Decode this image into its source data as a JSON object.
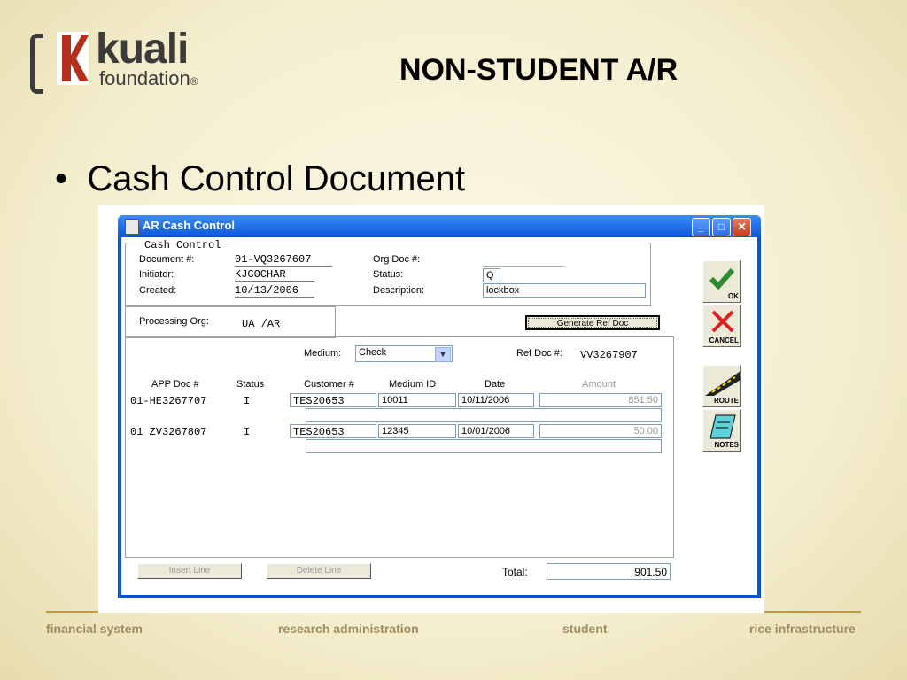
{
  "slide": {
    "logo_name": "kuali",
    "logo_sub": "foundation",
    "logo_reg": "®",
    "title": "NON-STUDENT A/R",
    "bullet": "Cash Control Document",
    "footer": [
      "financial system",
      "research administration",
      "student",
      "rice infrastructure"
    ]
  },
  "window": {
    "title": "AR Cash Control",
    "controls": {
      "min": "_",
      "max": "□",
      "close": "✕"
    }
  },
  "header": {
    "group_title": "Cash Control",
    "document_label": "Document #:",
    "document_value": "01-VQ3267607",
    "initiator_label": "Initiator:",
    "initiator_value": "KJCOCHAR",
    "created_label": "Created:",
    "created_value": "10/13/2006",
    "orgdoc_label": "Org Doc #:",
    "orgdoc_value": "",
    "status_label": "Status:",
    "status_value": "Q",
    "description_label": "Description:",
    "description_value": "lockbox",
    "processing_org_label": "Processing Org:",
    "processing_org_value": "UA /AR",
    "generate_button": "Generate Ref Doc"
  },
  "detail": {
    "medium_label": "Medium:",
    "medium_value": "Check",
    "refdoc_label": "Ref Doc #:",
    "refdoc_value": "VV3267907",
    "columns": [
      "APP Doc #",
      "Status",
      "Customer #",
      "Medium ID",
      "Date",
      "Amount"
    ],
    "rows": [
      {
        "app_doc": "01-HE3267707",
        "status": "I",
        "customer": "TES20653",
        "medium_id": "10011",
        "date": "10/11/2006",
        "amount": "851.50"
      },
      {
        "app_doc": "01 ZV3267807",
        "status": "I",
        "customer": "TES20653",
        "medium_id": "12345",
        "date": "10/01/2006",
        "amount": "50.00"
      }
    ],
    "insert_button": "Insert Line",
    "delete_button": "Delete Line",
    "total_label": "Total:",
    "total_value": "901.50"
  },
  "side_buttons": {
    "ok": "OK",
    "cancel": "CANCEL",
    "route": "ROUTE",
    "notes": "NOTES"
  },
  "colors": {
    "titlebar": "#0b56d8",
    "accent_green": "#2e8b2e",
    "cancel_red": "#e02020",
    "footer": "#a08d5e"
  }
}
